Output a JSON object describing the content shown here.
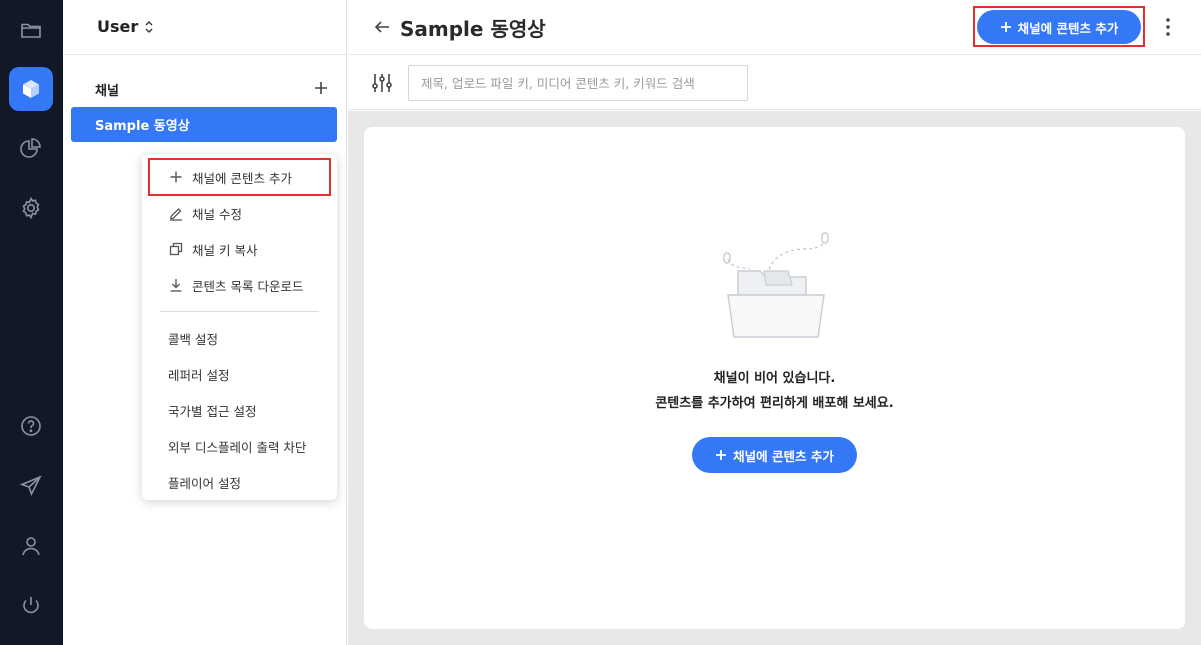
{
  "colors": {
    "accent": "#3478f6",
    "rail_bg": "#121826",
    "highlight": "#e52e2e"
  },
  "rail": {
    "icons": [
      "folder-icon",
      "cube-icon",
      "pie-chart-icon",
      "gear-icon",
      "help-icon",
      "send-icon",
      "user-icon",
      "power-icon"
    ],
    "active": "cube-icon"
  },
  "sidebar": {
    "user_label": "User",
    "channels_heading": "채널",
    "channels": [
      {
        "label": "Sample 동영상",
        "selected": true
      }
    ]
  },
  "context_menu": {
    "items": [
      {
        "label": "채널에 콘텐츠 추가",
        "icon": "plus-icon"
      },
      {
        "label": "채널 수정",
        "icon": "edit-icon"
      },
      {
        "label": "채널 키 복사",
        "icon": "copy-icon"
      },
      {
        "label": "콘텐츠 목록 다운로드",
        "icon": "download-icon"
      },
      {
        "label": "콜백 설정"
      },
      {
        "label": "레퍼러 설정"
      },
      {
        "label": "국가별 접근 설정"
      },
      {
        "label": "외부 디스플레이 출력 차단"
      },
      {
        "label": "플레이어 설정"
      }
    ]
  },
  "header": {
    "title": "Sample 동영상",
    "add_button_label": "채널에 콘텐츠 추가"
  },
  "toolbar": {
    "search_placeholder": "제목, 업로드 파일 키, 미디어 콘텐츠 키, 키워드 검색"
  },
  "empty_state": {
    "title": "채널이 비어 있습니다.",
    "subtitle": "콘텐츠를 추가하여 편리하게 배포해 보세요.",
    "button_label": "채널에 콘텐츠 추가"
  }
}
